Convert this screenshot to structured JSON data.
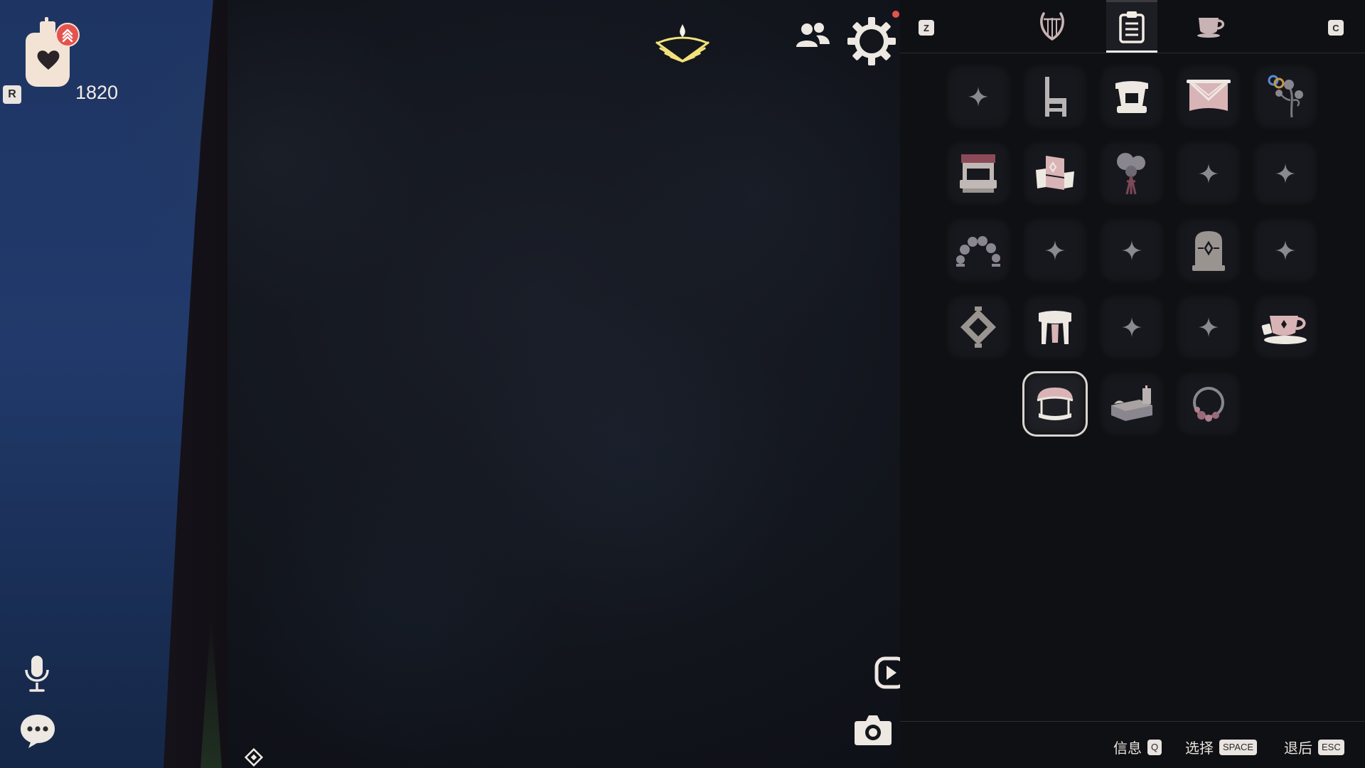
{
  "hud": {
    "candle_key": "R",
    "candle_count": "1820",
    "icons": {
      "candle": "candle-heart-icon",
      "notification": "level-up-badge-icon",
      "spirit": "winged-light-fan-icon",
      "friends": "friends-icon",
      "settings": "settings-gear-icon",
      "mic": "microphone-icon",
      "chat": "chat-bubble-icon",
      "home": "home-marker-icon",
      "video": "video-record-icon",
      "camera": "camera-icon"
    }
  },
  "panel": {
    "prev_key": "Z",
    "next_key": "C",
    "tabs": [
      {
        "icon": "lyre-icon",
        "active": false
      },
      {
        "icon": "clipboard-icon",
        "active": true
      },
      {
        "icon": "teacup-icon",
        "active": false
      }
    ],
    "slots": [
      {
        "icon": "empty-sparkle"
      },
      {
        "icon": "chair"
      },
      {
        "icon": "pedestal"
      },
      {
        "icon": "banner"
      },
      {
        "icon": "flower-branch"
      },
      {
        "icon": "market-stall"
      },
      {
        "icon": "armchair"
      },
      {
        "icon": "flower-bouquet"
      },
      {
        "icon": "empty-sparkle"
      },
      {
        "icon": "empty-sparkle"
      },
      {
        "icon": "arch"
      },
      {
        "icon": "empty-sparkle"
      },
      {
        "icon": "empty-sparkle"
      },
      {
        "icon": "tombstone"
      },
      {
        "icon": "empty-sparkle"
      },
      {
        "icon": "lantern"
      },
      {
        "icon": "stool"
      },
      {
        "icon": "empty-sparkle"
      },
      {
        "icon": "empty-sparkle"
      },
      {
        "icon": "teacup-set"
      },
      {
        "icon": "canopy-swing",
        "selected": true
      },
      {
        "icon": "bed"
      },
      {
        "icon": "flower-wreath"
      }
    ],
    "hints": [
      {
        "label": "信息",
        "key": "Q"
      },
      {
        "label": "选择",
        "key": "SPACE"
      },
      {
        "label": "退后",
        "key": "ESC"
      }
    ]
  },
  "colors": {
    "cream": "#f3e3d5",
    "badge_red": "#e5534f",
    "spirit_yellow": "#f2e27a",
    "panel_bg": "#0f1014",
    "slot_bg": "#17181d",
    "accent_pink": "#d9b4b6"
  }
}
